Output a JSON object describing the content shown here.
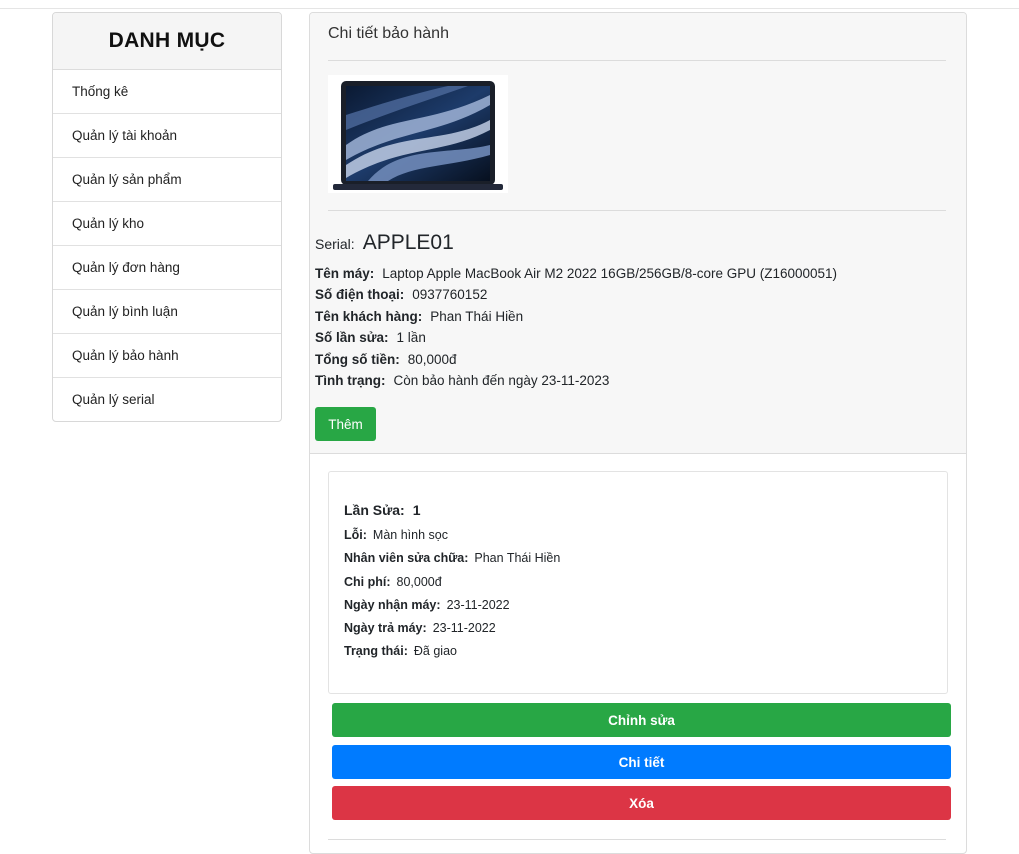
{
  "sidebar": {
    "title": "DANH MỤC",
    "items": [
      {
        "label": "Thống kê"
      },
      {
        "label": "Quản lý tài khoản"
      },
      {
        "label": "Quản lý sản phẩm"
      },
      {
        "label": "Quản lý kho"
      },
      {
        "label": "Quản lý đơn hàng"
      },
      {
        "label": "Quản lý bình luận"
      },
      {
        "label": "Quản lý bảo hành"
      },
      {
        "label": "Quản lý serial"
      }
    ]
  },
  "main": {
    "title": "Chi tiết bảo hành",
    "product_image": "laptop-macbook-air-image",
    "serial_label": "Serial:",
    "serial": "APPLE01",
    "details": [
      {
        "label": "Tên máy:",
        "value": "Laptop Apple MacBook Air M2 2022 16GB/256GB/8-core GPU (Z16000051)"
      },
      {
        "label": "Số điện thoại:",
        "value": "0937760152"
      },
      {
        "label": "Tên khách hàng:",
        "value": "Phan Thái Hiền"
      },
      {
        "label": "Số lần sửa:",
        "value": "1 lần"
      },
      {
        "label": "Tổng số tiền:",
        "value": "80,000đ"
      },
      {
        "label": "Tình trạng:",
        "value": "Còn bảo hành đến ngày 23-11-2023"
      }
    ],
    "add_button": "Thêm"
  },
  "repair": {
    "count_label": "Lần Sửa:",
    "count_value": "1",
    "fields": [
      {
        "label": "Lỗi:",
        "value": "Màn hình sọc"
      },
      {
        "label": "Nhân viên sửa chữa:",
        "value": "Phan Thái Hiền"
      },
      {
        "label": "Chi phí:",
        "value": "80,000đ"
      },
      {
        "label": "Ngày nhận máy:",
        "value": "23-11-2022"
      },
      {
        "label": "Ngày trả máy:",
        "value": "23-11-2022"
      },
      {
        "label": "Trạng thái:",
        "value": "Đã giao"
      }
    ],
    "edit_button": "Chỉnh sửa",
    "detail_button": "Chi tiết",
    "delete_button": "Xóa"
  },
  "colors": {
    "success": "#28a745",
    "primary": "#007bff",
    "danger": "#dc3545"
  }
}
